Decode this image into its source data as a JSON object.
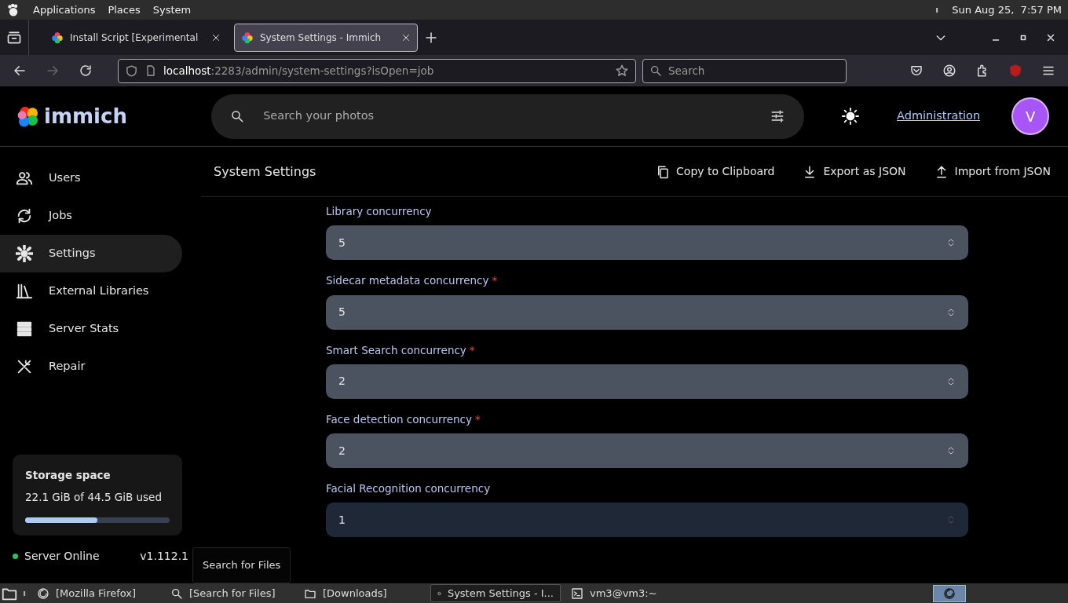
{
  "desktop_bar": {
    "menus": [
      "Applications",
      "Places",
      "System"
    ],
    "clock": "Sun Aug 25,  7:57 PM"
  },
  "browser": {
    "tabs": [
      {
        "title": "Install Script [Experimental",
        "selected": false
      },
      {
        "title": "System Settings - Immich",
        "selected": true
      }
    ],
    "url_host": "localhost",
    "url_path": ":2283/admin/system-settings?isOpen=job",
    "search_placeholder": "Search"
  },
  "app": {
    "logo": "immich",
    "search_placeholder": "Search your photos",
    "admin_link": "Administration",
    "avatar": "V"
  },
  "sidebar": {
    "items": [
      {
        "label": "Users",
        "kind": "users",
        "selected": false
      },
      {
        "label": "Jobs",
        "kind": "sync",
        "selected": false
      },
      {
        "label": "Settings",
        "kind": "gear",
        "selected": true
      },
      {
        "label": "External Libraries",
        "kind": "library",
        "selected": false
      },
      {
        "label": "Server Stats",
        "kind": "server",
        "selected": false
      },
      {
        "label": "Repair",
        "kind": "tools",
        "selected": false
      }
    ]
  },
  "storage": {
    "title": "Storage space",
    "usage": "22.1 GiB of 44.5 GiB used",
    "level": 0.5
  },
  "server": {
    "status": "Server Online",
    "online": true,
    "version": "v1.112.1"
  },
  "page": {
    "title": "System Settings",
    "actions": [
      {
        "label": "Copy to Clipboard",
        "kind": "copy"
      },
      {
        "label": "Export as JSON",
        "kind": "download"
      },
      {
        "label": "Import from JSON",
        "kind": "upload"
      }
    ]
  },
  "required_marker": "*",
  "fields": [
    {
      "label": "Library concurrency",
      "value": "5",
      "required": false,
      "disabled": false
    },
    {
      "label": "Sidecar metadata concurrency",
      "value": "5",
      "required": true,
      "disabled": false
    },
    {
      "label": "Smart Search concurrency",
      "value": "2",
      "required": true,
      "disabled": false
    },
    {
      "label": "Face detection concurrency",
      "value": "2",
      "required": true,
      "disabled": false
    },
    {
      "label": "Facial Recognition concurrency",
      "value": "1",
      "required": false,
      "disabled": true
    }
  ],
  "tooltip": "Search for Files",
  "taskbar": {
    "items": [
      {
        "label": "[Mozilla Firefox]",
        "kind": "firefox",
        "selected": false
      },
      {
        "label": "[Search for Files]",
        "kind": "search",
        "selected": false
      },
      {
        "label": "[Downloads]",
        "kind": "folder",
        "selected": false
      },
      {
        "label": "System Settings - I...",
        "kind": "firefox",
        "selected": true
      },
      {
        "label": "vm3@vm3:~",
        "kind": "terminal",
        "selected": false
      }
    ]
  }
}
